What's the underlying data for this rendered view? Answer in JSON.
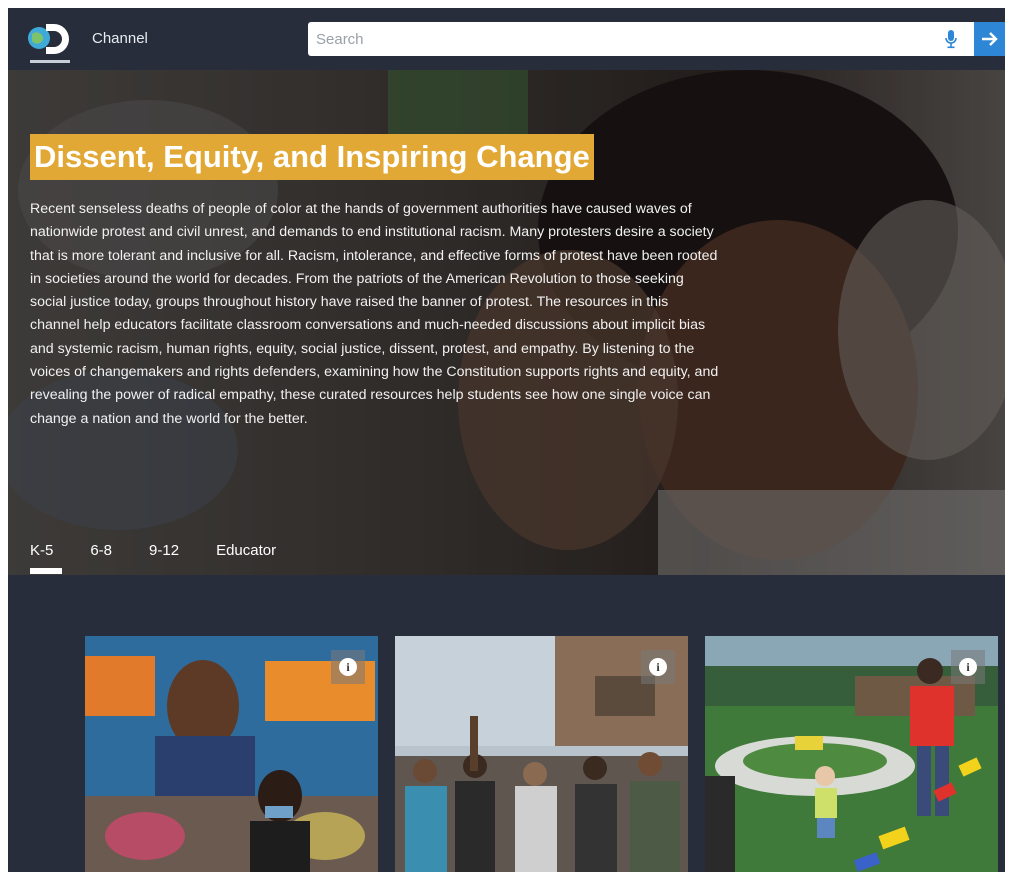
{
  "header": {
    "logo_alt": "Discovery Education",
    "channel_label": "Channel",
    "search": {
      "placeholder": "Search",
      "value": ""
    }
  },
  "hero": {
    "title": "Dissent, Equity, and Inspiring Change",
    "description": "Recent senseless deaths of people of color at the hands of government authorities have caused waves of nationwide protest and civil unrest, and demands to end institutional racism. Many protesters desire a society that is more tolerant and inclusive for all. Racism, intolerance, and effective forms of protest have been rooted in societies around the world for decades. From the patriots of the American Revolution to those seeking social justice today, groups throughout history have raised the banner of protest. The resources in this channel help educators facilitate classroom conversations and much-needed discussions about implicit bias and systemic racism, human rights, equity, social justice, dissent, protest, and empathy. By listening to the voices of changemakers and rights defenders, examining how the Constitution supports rights and equity, and revealing the power of radical empathy, these curated resources help students see how one single voice can change a nation and the world for the better.",
    "highlight_color": "#e2a836"
  },
  "tabs": [
    {
      "label": "K-5",
      "active": true
    },
    {
      "label": "6-8",
      "active": false
    },
    {
      "label": "9-12",
      "active": false
    },
    {
      "label": "Educator",
      "active": false
    }
  ],
  "cards": [
    {
      "image": "protest-mural-photo",
      "info_icon": "i"
    },
    {
      "image": "raised-fists-crowd-photo",
      "info_icon": "i"
    },
    {
      "image": "playground-children-photo",
      "info_icon": "i"
    }
  ],
  "colors": {
    "background": "#272d3a",
    "accent": "#2e86d6"
  }
}
